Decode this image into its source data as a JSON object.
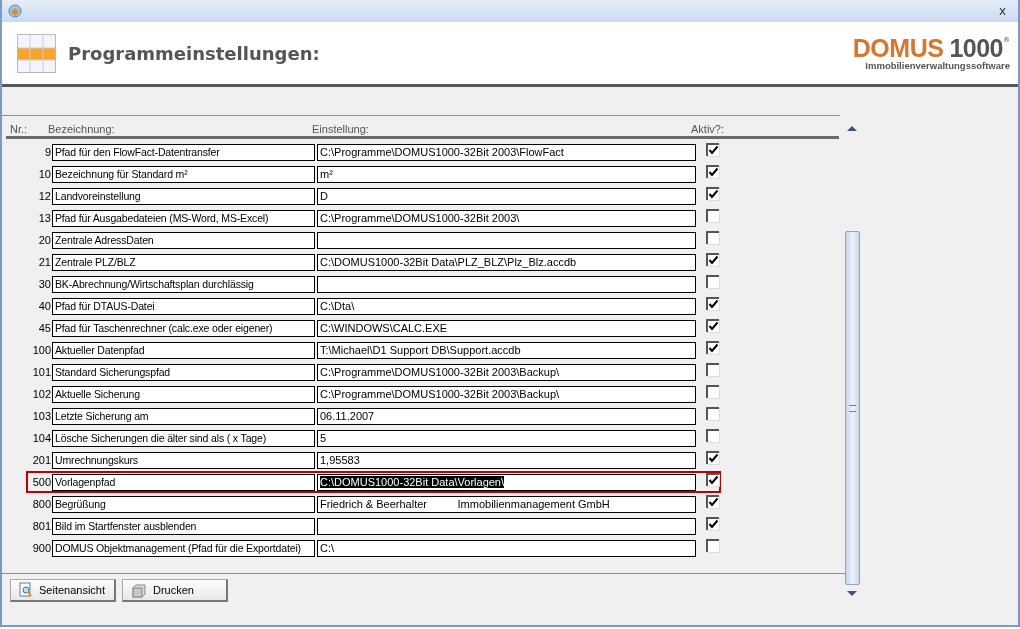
{
  "window": {
    "close": "x"
  },
  "header": {
    "title": "Programmeinstellungen:",
    "logo_brand": "DOMUS",
    "logo_number": "1000",
    "logo_mark": "®",
    "logo_tagline": "Immobilienverwaltungssoftware"
  },
  "table": {
    "columns": [
      "Nr.:",
      "Bezeichnung:",
      "Einstellung:",
      "Aktiv?:"
    ],
    "rows": [
      {
        "nr": "9",
        "name": "Pfad für den FlowFact-Datentransfer",
        "value": "C:\\Programme\\DOMUS1000-32Bit 2003\\FlowFact",
        "active": true,
        "selected": false
      },
      {
        "nr": "10",
        "name": "Bezeichnung für Standard m²",
        "value": "m²",
        "active": true,
        "selected": false
      },
      {
        "nr": "12",
        "name": "Landvoreinstellung",
        "value": "D",
        "active": true,
        "selected": false
      },
      {
        "nr": "13",
        "name": "Pfad für Ausgabedateien (MS-Word, MS-Excel)",
        "value": "C:\\Programme\\DOMUS1000-32Bit 2003\\",
        "active": false,
        "selected": false
      },
      {
        "nr": "20",
        "name": "Zentrale AdressDaten",
        "value": "",
        "active": false,
        "selected": false
      },
      {
        "nr": "21",
        "name": "Zentrale PLZ/BLZ",
        "value": "C:\\DOMUS1000-32Bit Data\\PLZ_BLZ\\Plz_Blz.accdb",
        "active": true,
        "selected": false
      },
      {
        "nr": "30",
        "name": "BK-Abrechnung/Wirtschaftsplan durchlässig",
        "value": "",
        "active": false,
        "selected": false
      },
      {
        "nr": "40",
        "name": "Pfad für DTAUS-Datei",
        "value": "C:\\Dta\\",
        "active": true,
        "selected": false
      },
      {
        "nr": "45",
        "name": "Pfad für Taschenrechner (calc.exe oder eigener)",
        "value": "C:\\WINDOWS\\CALC.EXE",
        "active": true,
        "selected": false
      },
      {
        "nr": "100",
        "name": "Aktueller Datenpfad",
        "value": "T:\\Michael\\D1 Support DB\\Support.accdb",
        "active": true,
        "selected": false
      },
      {
        "nr": "101",
        "name": "Standard Sicherungspfad",
        "value": "C:\\Programme\\DOMUS1000-32Bit 2003\\Backup\\",
        "active": false,
        "selected": false
      },
      {
        "nr": "102",
        "name": "Aktuelle Sicherung",
        "value": "C:\\Programme\\DOMUS1000-32Bit 2003\\Backup\\",
        "active": false,
        "selected": false
      },
      {
        "nr": "103",
        "name": "Letzte Sicherung am",
        "value": "06.11.2007",
        "active": false,
        "selected": false
      },
      {
        "nr": "104",
        "name": "Lösche Sicherungen die älter sind als ( x Tage)",
        "value": "5",
        "active": false,
        "selected": false
      },
      {
        "nr": "201",
        "name": "Umrechnungskurs",
        "value": "1,95583",
        "active": true,
        "selected": false
      },
      {
        "nr": "500",
        "name": "Vorlagenpfad",
        "value": "C:\\DOMUS1000-32Bit Data\\Vorlagen\\",
        "active": true,
        "selected": true
      },
      {
        "nr": "800",
        "name": "Begrüßung",
        "value": "Friedrich & Beerhalter          Immobilienmanagement GmbH",
        "active": true,
        "selected": false
      },
      {
        "nr": "801",
        "name": "Bild im Startfenster ausblenden",
        "value": "",
        "active": true,
        "selected": false
      },
      {
        "nr": "900",
        "name": "DOMUS Objektmanagement (Pfad für die Exportdatei)",
        "value": "C:\\",
        "active": false,
        "selected": false
      }
    ]
  },
  "buttons": [
    {
      "label": "Seitenansicht",
      "kind": "preview"
    },
    {
      "label": "Drucken",
      "kind": "print"
    }
  ]
}
